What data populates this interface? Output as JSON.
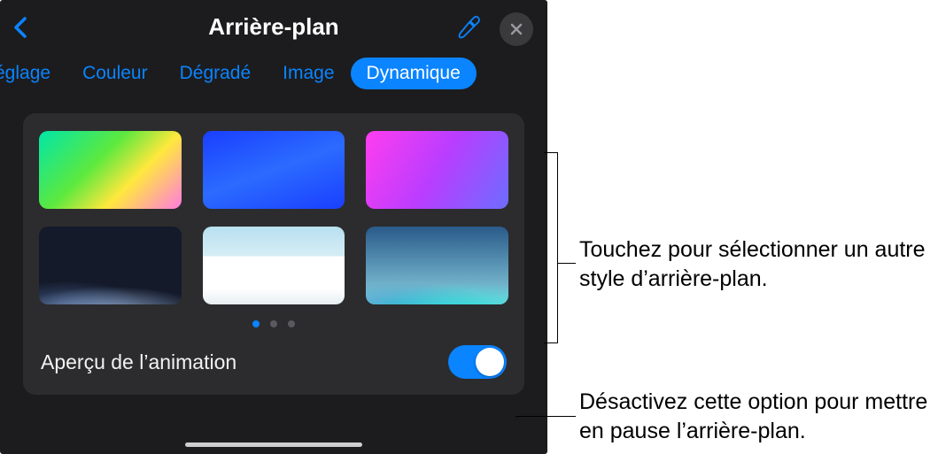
{
  "header": {
    "title": "Arrière-plan"
  },
  "tabs": {
    "items": [
      {
        "label": "églage"
      },
      {
        "label": "Couleur"
      },
      {
        "label": "Dégradé"
      },
      {
        "label": "Image"
      },
      {
        "label": "Dynamique"
      }
    ],
    "active_index": 4
  },
  "thumbnails": [
    {
      "name": "dynamic-green-rainbow"
    },
    {
      "name": "dynamic-blue"
    },
    {
      "name": "dynamic-magenta-violet"
    },
    {
      "name": "dynamic-dark-hills"
    },
    {
      "name": "dynamic-white-clouds"
    },
    {
      "name": "dynamic-teal-hills"
    }
  ],
  "pagination": {
    "page_count": 3,
    "active_page": 0
  },
  "preview": {
    "label": "Aperçu de l’animation",
    "enabled": true
  },
  "callouts": {
    "thumbnails_text": "Touchez pour sélectionner un autre style d’arrière-plan.",
    "toggle_text": "Désactivez cette option pour mettre en pause l’arrière-plan."
  },
  "colors": {
    "accent": "#0a84ff",
    "panel_bg": "#1c1c1e",
    "card_bg": "#2c2c2e"
  }
}
